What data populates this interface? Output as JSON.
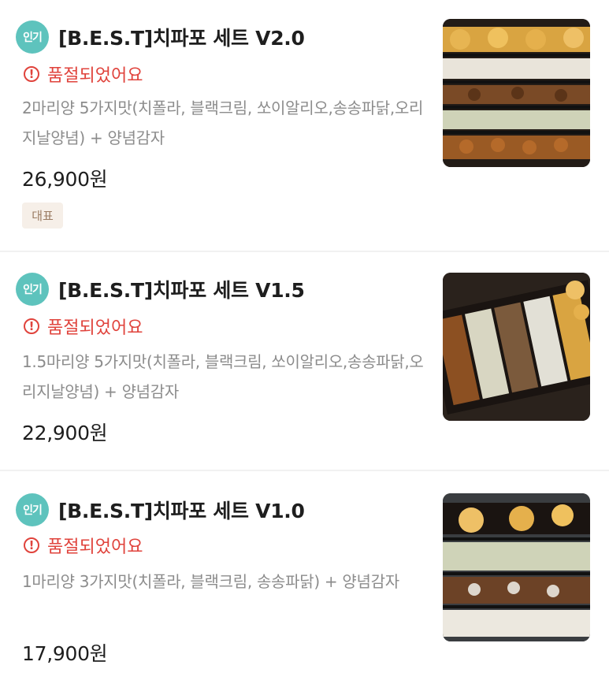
{
  "items": [
    {
      "badge": "인기",
      "title": "[B.E.S.T]치파포 세트 V2.0",
      "status": "품절되었어요",
      "description": "2마리양 5가지맛(치폴라, 블랙크림, 쏘이알리오,송송파닭,오리지날양념) + 양념감자",
      "price": "26,900원",
      "tag": "대표",
      "image": "fried-chicken-box-photo"
    },
    {
      "badge": "인기",
      "title": "[B.E.S.T]치파포 세트 V1.5",
      "status": "품절되었어요",
      "description": "1.5마리양 5가지맛(치폴라, 블랙크림, 쏘이알리오,송송파닭,오리지날양념) + 양념감자",
      "price": "22,900원",
      "image": "fried-chicken-box-photo"
    },
    {
      "badge": "인기",
      "title": "[B.E.S.T]치파포 세트 V1.0",
      "status": "품절되었어요",
      "description": "1마리양 3가지맛(치폴라, 블랙크림, 송송파닭) + 양념감자",
      "price": "17,900원",
      "image": "fried-chicken-box-photo"
    }
  ],
  "colors": {
    "badge": "#5ec3bd",
    "soldout": "#e0433c",
    "tag_bg": "#f6efe8",
    "tag_text": "#9a7b62"
  }
}
